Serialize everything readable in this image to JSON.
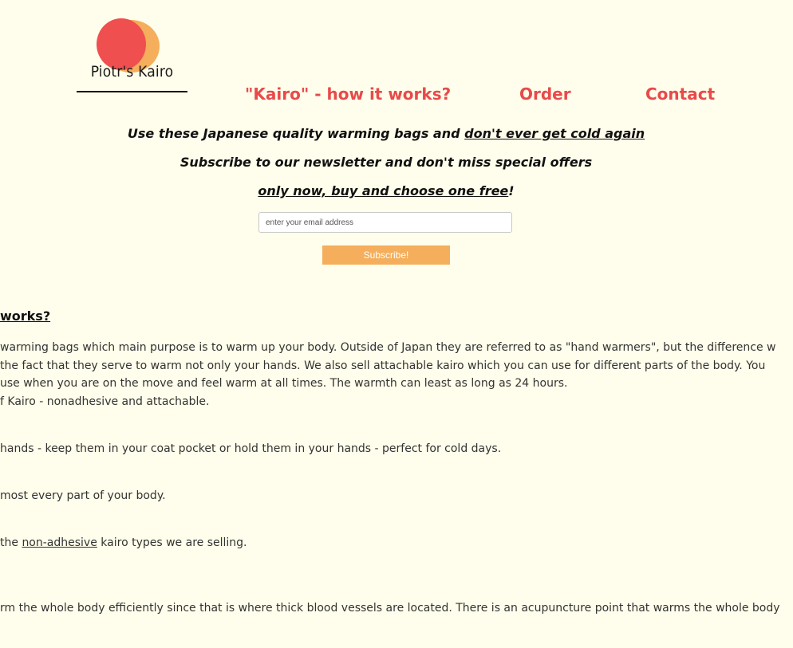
{
  "logo": {
    "text": "Piotr's Kairo"
  },
  "nav": {
    "how": "\"Kairo\" - how it works?",
    "order": "Order",
    "contact": "Contact"
  },
  "promo": {
    "line1_pre": "Use these Japanese quality warming bags and ",
    "line1_link": "don't ever get cold again",
    "line2": "Subscribe to our newsletter and don't miss special offers",
    "line3_link": "only now, buy and choose one free",
    "line3_post": "!"
  },
  "subscribe": {
    "placeholder": "enter your email address",
    "button": "Subscribe!"
  },
  "section": {
    "heading": "works?",
    "para1": [
      "warming bags which main purpose is to warm up your body. Outside of Japan they are referred to as \"hand warmers\", but the difference w",
      " the fact that they serve to warm not only your hands. We also sell attachable kairo which you can use for different parts of the body. You",
      " use when you are on the move and feel warm at all times. The warmth can least as long as 24 hours.",
      "f Kairo - nonadhesive and attachable."
    ],
    "para2": "hands - keep them in your coat pocket or hold them in your hands - perfect for cold days.",
    "para3": "most every part of your body.",
    "para4_pre": "the ",
    "para4_link": "non-adhesive",
    "para4_post": " kairo types we are selling.",
    "para5": "rm the whole body efficiently since that is where thick blood vessels are located. There is an acupuncture point that warms the whole body"
  },
  "colors": {
    "accent": "#e84a4a",
    "orange": "#f5ae5b",
    "background": "#fffdeb"
  }
}
